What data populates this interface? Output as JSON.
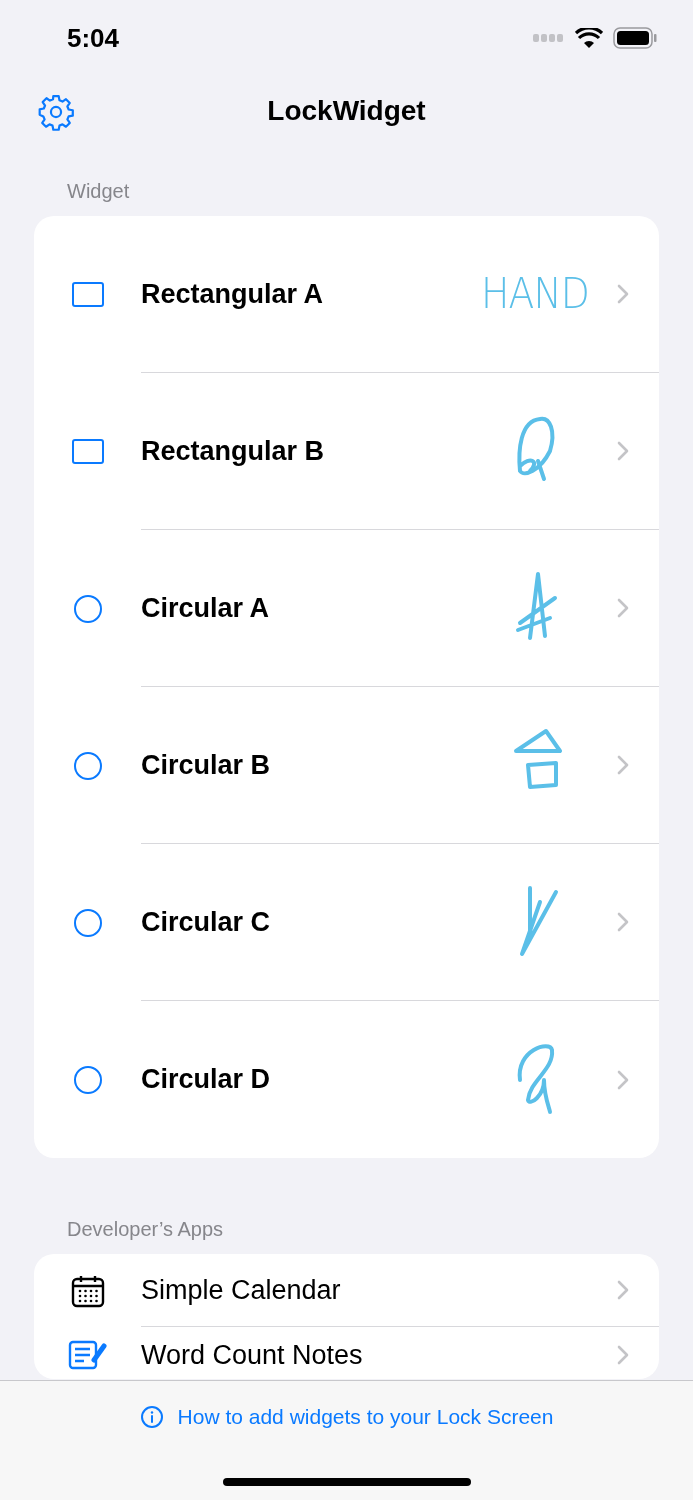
{
  "status_bar": {
    "time": "5:04"
  },
  "nav": {
    "title": "LockWidget"
  },
  "sections": [
    {
      "header": "Widget",
      "kind": "widgets",
      "items": [
        {
          "kind": "rectangular",
          "label": "Rectangular A",
          "sketch": {
            "kind": "text",
            "text": "HAND"
          }
        },
        {
          "kind": "rectangular",
          "label": "Rectangular B",
          "sketch": {
            "kind": "scribble"
          }
        },
        {
          "kind": "circular",
          "label": "Circular A",
          "sketch": {
            "kind": "scribble"
          }
        },
        {
          "kind": "circular",
          "label": "Circular B",
          "sketch": {
            "kind": "scribble"
          }
        },
        {
          "kind": "circular",
          "label": "Circular C",
          "sketch": {
            "kind": "scribble"
          }
        },
        {
          "kind": "circular",
          "label": "Circular D",
          "sketch": {
            "kind": "scribble"
          }
        }
      ]
    },
    {
      "header": "Developer’s Apps",
      "kind": "apps",
      "items": [
        {
          "kind": "calendar",
          "label": "Simple Calendar"
        },
        {
          "kind": "notes",
          "label": "Word Count Notes"
        }
      ]
    }
  ],
  "bottom_bar": {
    "link": "How to add widgets to your Lock Screen"
  }
}
